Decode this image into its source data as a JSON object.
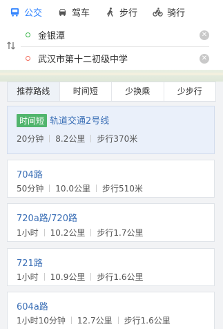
{
  "modes": [
    {
      "label": "公交",
      "icon": "bus-icon",
      "active": true
    },
    {
      "label": "驾车",
      "icon": "car-icon",
      "active": false
    },
    {
      "label": "步行",
      "icon": "walk-icon",
      "active": false
    },
    {
      "label": "骑行",
      "icon": "bike-icon",
      "active": false
    }
  ],
  "search": {
    "start": "金银潭",
    "end": "武汉市第十二初级中学"
  },
  "sort_tabs": [
    {
      "label": "推荐路线",
      "active": true
    },
    {
      "label": "时间短",
      "active": false
    },
    {
      "label": "少换乘",
      "active": false
    },
    {
      "label": "少步行",
      "active": false
    }
  ],
  "routes": [
    {
      "badge": "时间短",
      "name": "轨道交通2号线",
      "duration": "20分钟",
      "distance": "8.2公里",
      "walk": "步行370米",
      "active": true
    },
    {
      "badge": "",
      "name": "704路",
      "duration": "50分钟",
      "distance": "10.0公里",
      "walk": "步行510米",
      "active": false
    },
    {
      "badge": "",
      "name": "720a路/720路",
      "duration": "1小时",
      "distance": "10.2公里",
      "walk": "步行1.7公里",
      "active": false
    },
    {
      "badge": "",
      "name": "721路",
      "duration": "1小时",
      "distance": "10.9公里",
      "walk": "步行1.6公里",
      "active": false
    },
    {
      "badge": "",
      "name": "604a路",
      "duration": "1小时10分钟",
      "distance": "12.7公里",
      "walk": "步行1.6公里",
      "active": false
    }
  ],
  "colors": {
    "accent": "#3385ff",
    "link": "#3b6fb6",
    "badge": "#51b56d"
  }
}
